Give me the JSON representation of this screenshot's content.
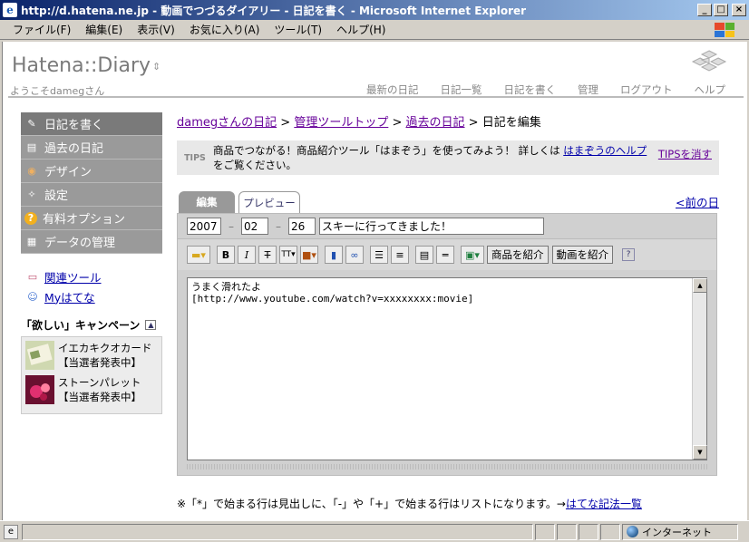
{
  "window": {
    "title": "http://d.hatena.ne.jp - 動画でつづるダイアリー - 日記を書く - Microsoft Internet Explorer",
    "controls": [
      "_",
      "□",
      "×"
    ]
  },
  "menubar": {
    "items": [
      "ファイル(F)",
      "編集(E)",
      "表示(V)",
      "お気に入り(A)",
      "ツール(T)",
      "ヘルプ(H)"
    ]
  },
  "header": {
    "logo": "Hatena::Diary",
    "logo_arrows": "⇕",
    "welcome": "ようこそdamegさん",
    "nav": [
      "最新の日記",
      "日記一覧",
      "日記を書く",
      "管理",
      "ログアウト",
      "ヘルプ"
    ]
  },
  "sidebar": {
    "items": [
      {
        "label": "日記を書く",
        "icon": "pencil-icon",
        "glyph": "✎"
      },
      {
        "label": "過去の日記",
        "icon": "book-icon",
        "glyph": "▤"
      },
      {
        "label": "デザイン",
        "icon": "palette-icon",
        "glyph": "◉"
      },
      {
        "label": "設定",
        "icon": "wrench-icon",
        "glyph": "✧"
      },
      {
        "label": "有料オプション",
        "icon": "question-icon",
        "glyph": "?"
      },
      {
        "label": "データの管理",
        "icon": "table-icon",
        "glyph": "▦"
      }
    ],
    "links": [
      {
        "label": "関連ツール",
        "icon": "toolbox-icon",
        "glyph": "▭"
      },
      {
        "label": "Myはてな",
        "icon": "user-icon",
        "glyph": "☺"
      }
    ],
    "campaign_title": "「欲しい」キャンペーン",
    "campaign_items": [
      {
        "name": "イエカキクオカード",
        "status": "【当選者発表中】"
      },
      {
        "name": "ストーンパレット",
        "status": "【当選者発表中】"
      }
    ]
  },
  "main": {
    "breadcrumb": {
      "links": [
        "damegさんの日記",
        "管理ツールトップ",
        "過去の日記"
      ],
      "sep": " > ",
      "current": "日記を編集"
    },
    "tips": {
      "label": "TIPS",
      "text_before": "商品でつながる！商品紹介ツール「はまぞう」を使ってみよう！ 詳しくは ",
      "link": "はまぞうのヘルプ",
      "text_after": " をご覧ください。",
      "close": "TIPSを消す"
    },
    "tabs": {
      "edit": "編集",
      "preview": "プレビュー"
    },
    "prev_day": "<前の日",
    "date": {
      "year": "2007",
      "month": "02",
      "day": "26",
      "dash": "–"
    },
    "title_value": "スキーに行ってきました！",
    "toolbar": {
      "buttons": [
        "folder-icon",
        "bold-icon",
        "italic-icon",
        "strike-icon",
        "font-size-icon",
        "color-icon",
        "book-link-icon",
        "link-icon",
        "unordered-list-icon",
        "ordered-list-icon",
        "blockquote-icon",
        "hr-icon",
        "image-icon"
      ],
      "product_button": "商品を紹介",
      "video_button": "動画を紹介",
      "help": "?"
    },
    "body_text": "うまく滑れたよ\n[http://www.youtube.com/watch?v=xxxxxxxx:movie]",
    "note_text": "※「*」で始まる行は見出しに、「-」や「+」で始まる行はリストになります。→",
    "note_link": "はてな記法一覧"
  },
  "statusbar": {
    "zone": "インターネット"
  }
}
